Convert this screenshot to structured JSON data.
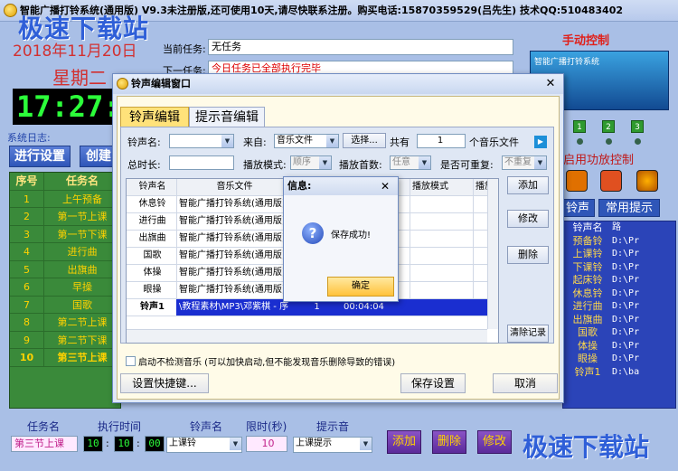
{
  "window": {
    "title": "智能广播打铃系统(通用版) V9.3未注册版,还可使用10天,请尽快联系注册。购买电话:15870359529(吕先生) 技术QQ:510483402",
    "watermark": "极速下载站"
  },
  "left": {
    "date": "2018年11月20日",
    "weekday": "星期二",
    "clock": "17:27:5",
    "syslog_label": "系统日志:",
    "run_btn": "进行设置",
    "create_btn": "创建",
    "grid_headers": [
      "序号",
      "任务名"
    ],
    "grid_rows": [
      [
        "1",
        "上午预备"
      ],
      [
        "2",
        "第一节上课"
      ],
      [
        "3",
        "第一节下课"
      ],
      [
        "4",
        "进行曲"
      ],
      [
        "5",
        "出旗曲"
      ],
      [
        "6",
        "早操"
      ],
      [
        "7",
        "国歌"
      ],
      [
        "8",
        "第二节上课"
      ],
      [
        "9",
        "第二节下课"
      ],
      [
        "10",
        "第三节上课"
      ]
    ]
  },
  "header": {
    "task_label": "当前任务:",
    "task_value": "无任务",
    "next_label": "下一任务:",
    "next_value": "今日任务已全部执行完毕"
  },
  "right": {
    "manual_title": "手动控制",
    "banner_text": "智能广播打铃系统",
    "channels": [
      "1",
      "2",
      "3"
    ],
    "amp_label": "启用功放控制",
    "tabs": [
      "铃声",
      "常用提示"
    ],
    "grid_header": [
      "铃声名",
      "路"
    ],
    "grid_rows": [
      [
        "预备铃",
        "D:\\Pr"
      ],
      [
        "上课铃",
        "D:\\Pr"
      ],
      [
        "下课铃",
        "D:\\Pr"
      ],
      [
        "起床铃",
        "D:\\Pr"
      ],
      [
        "休息铃",
        "D:\\Pr"
      ],
      [
        "进行曲",
        "D:\\Pr"
      ],
      [
        "出旗曲",
        "D:\\Pr"
      ],
      [
        "国歌",
        "D:\\Pr"
      ],
      [
        "体操",
        "D:\\Pr"
      ],
      [
        "眼操",
        "D:\\Pr"
      ],
      [
        "铃声1",
        "D:\\ba"
      ]
    ]
  },
  "bottom": {
    "labels": [
      "任务名",
      "执行时间",
      "铃声名",
      "限时(秒)",
      "提示音"
    ],
    "task_name": "第三节上课",
    "hour": "10",
    "minute": "10",
    "second": "00",
    "ring": "上课铃",
    "limit": "10",
    "prompt": "上课提示",
    "buttons": [
      "添加",
      "删除",
      "修改"
    ]
  },
  "dialog": {
    "title": "铃声编辑窗口",
    "tabs": [
      "铃声编辑",
      "提示音编辑"
    ],
    "ring_name_label": "铃声名:",
    "source_label": "来自:",
    "source_value": "音乐文件",
    "browse_btn": "选择...",
    "total_label": "共有",
    "total_value": "1",
    "total_suffix": "个音乐文件",
    "duration_label": "总时长:",
    "mode_label": "播放模式:",
    "mode_value": "顺序",
    "count_label": "播放首数:",
    "count_value": "任意",
    "repeat_label": "是否可重复:",
    "repeat_value": "不重复",
    "table_headers": [
      "铃声名",
      "音乐文件",
      "",
      "",
      "播放模式",
      "播放"
    ],
    "table_rows": [
      [
        "休息铃",
        "智能广播打铃系统(通用版)\\",
        "",
        "",
        "",
        ""
      ],
      [
        "进行曲",
        "智能广播打铃系统(通用版)\\",
        "",
        "",
        "",
        ""
      ],
      [
        "出旗曲",
        "智能广播打铃系统(通用版)\\",
        "",
        "",
        "",
        ""
      ],
      [
        "国歌",
        "智能广播打铃系统(通用版)\\",
        "",
        "",
        "",
        ""
      ],
      [
        "体操",
        "智能广播打铃系统(通用版)\\",
        "",
        "",
        "",
        ""
      ],
      [
        "眼操",
        "智能广播打铃系统(通用版)\\",
        "",
        "",
        "",
        ""
      ]
    ],
    "selected_row": [
      "铃声1",
      "\\教程素材\\MP3\\邓紫棋 - 序",
      "1",
      "00:04:04",
      "",
      ""
    ],
    "side_buttons": [
      "添加",
      "修改",
      "删除",
      "清除记录"
    ],
    "checkbox_label": "启动不检测音乐 (可以加快启动,但不能发现音乐删除导致的错误)",
    "shortcut_btn": "设置快捷键...",
    "save_btn": "保存设置",
    "cancel_btn": "取消"
  },
  "msgbox": {
    "title": "信息:",
    "icon": "question-icon",
    "text": "保存成功!",
    "ok": "确定"
  }
}
